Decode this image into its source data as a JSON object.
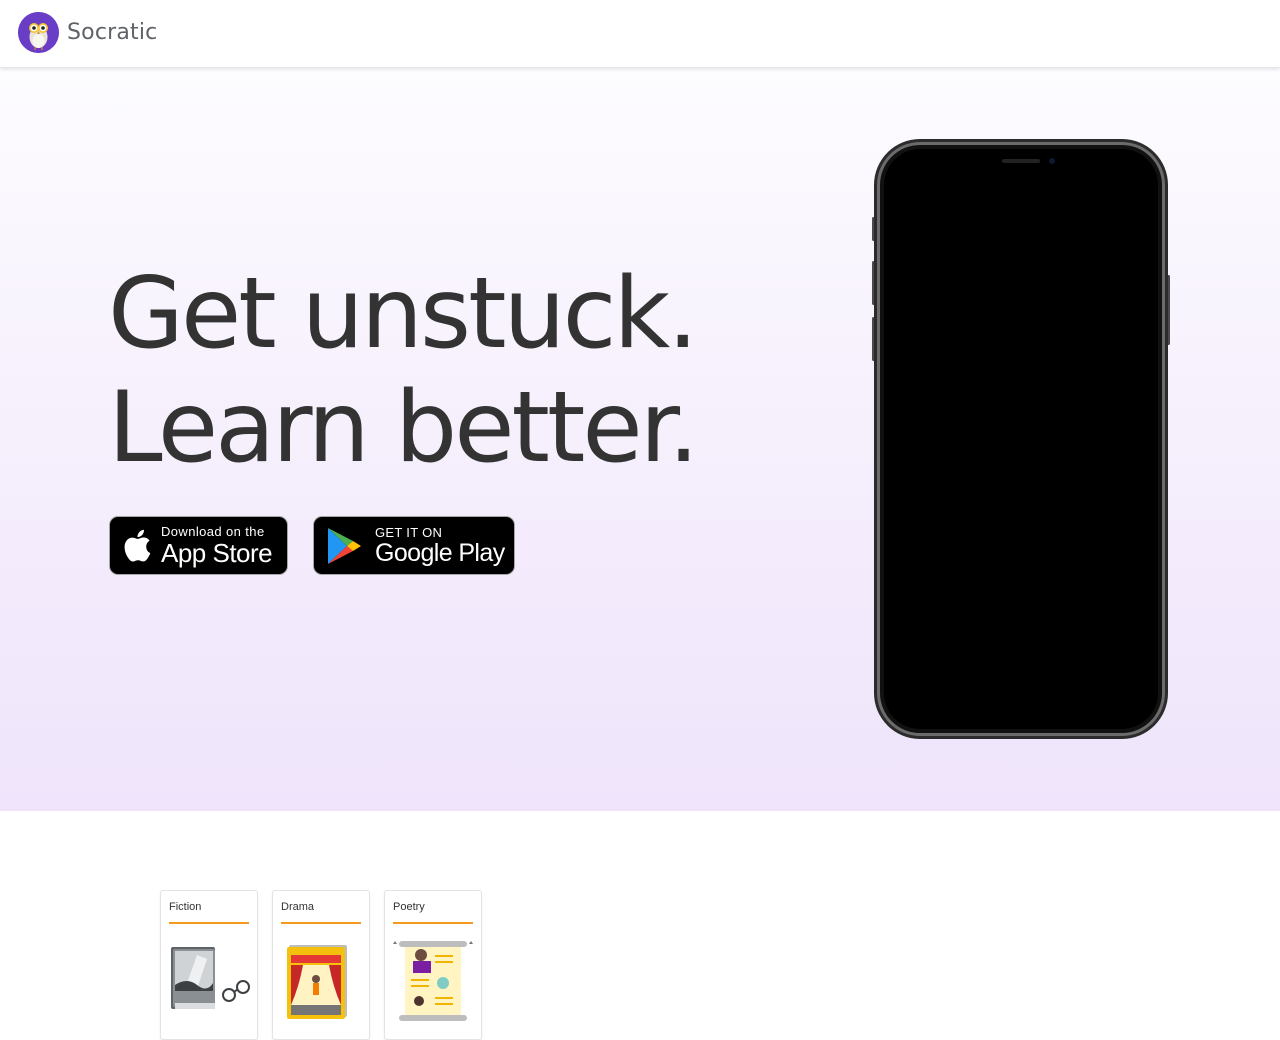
{
  "header": {
    "brand": "Socratic",
    "logo_icon": "owl-logo-icon"
  },
  "hero": {
    "headline_line1": "Get unstuck.",
    "headline_line2": "Learn better.",
    "appstore": {
      "small": "Download on the",
      "big": "App Store",
      "icon": "apple-icon"
    },
    "googleplay": {
      "small": "GET IT ON",
      "big": "Google Play",
      "icon": "google-play-icon"
    }
  },
  "cards": [
    {
      "title": "Fiction",
      "icon": "book-glasses-icon"
    },
    {
      "title": "Drama",
      "icon": "theater-stage-icon"
    },
    {
      "title": "Poetry",
      "icon": "scroll-poem-icon"
    }
  ],
  "colors": {
    "brand_purple": "#6a3dc7",
    "headline": "#333333",
    "card_accent": "#f29b1d"
  }
}
